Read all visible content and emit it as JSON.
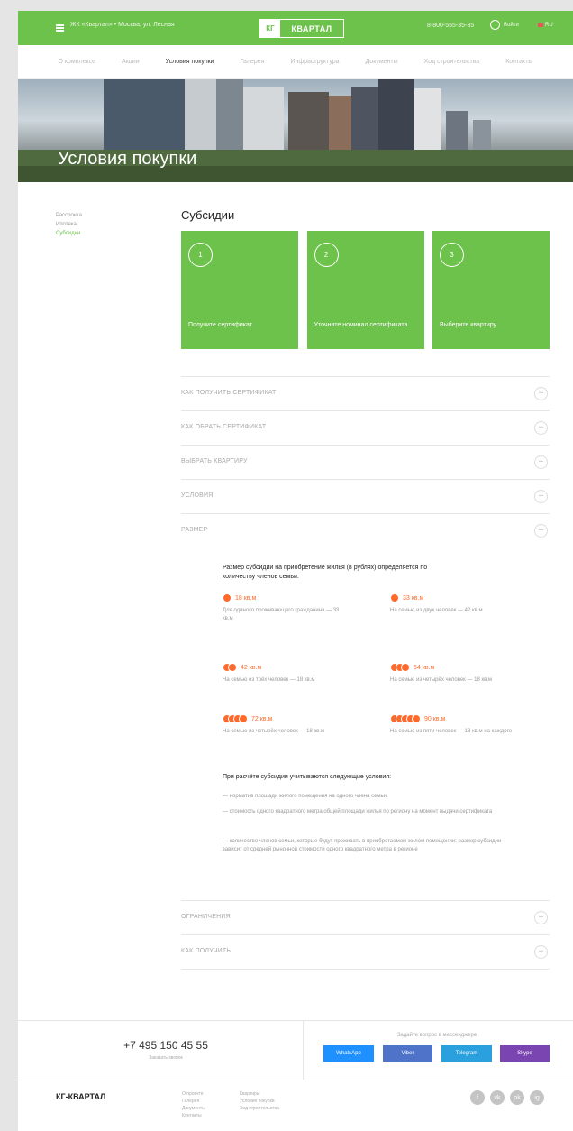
{
  "header": {
    "address": "ЖК «Квартал» • Москва, ул. Лесная",
    "logo_mark": "КГ",
    "logo_word": "КВАРТАЛ",
    "phone": "8-800-555-35-35",
    "login": "Войти",
    "lang": "RU"
  },
  "nav": [
    "О комплексе",
    "Акции",
    "Условия покупки",
    "Галерея",
    "Инфраструктура",
    "Документы",
    "Ход строительства",
    "Контакты"
  ],
  "hero": {
    "title": "Условия покупки"
  },
  "sidebar": [
    "Рассрочка",
    "Ипотека",
    "Субсидии"
  ],
  "subsidy": {
    "title": "Субсидии",
    "steps": [
      {
        "num": "1",
        "text": "Получите сертификат"
      },
      {
        "num": "2",
        "text": "Уточните номинал сертификата"
      },
      {
        "num": "3",
        "text": "Выберите квартиру"
      }
    ]
  },
  "accordion": [
    "КАК ПОЛУЧИТЬ СЕРТИФИКАТ",
    "КАК ОБРАТЬ СЕРТИФИКАТ",
    "ВЫБРАТЬ КВАРТИРУ",
    "УСЛОВИЯ",
    "РАЗМЕР",
    "ОГРАНИЧЕНИЯ",
    "КАК ПОЛУЧИТЬ"
  ],
  "size": {
    "intro": "Размер субсидии на приобретение жилья (в рублях) определяется по количеству членов семьи.",
    "values": [
      {
        "amount": "18 кв.м",
        "desc": "Для одиноко проживающего гражданина — 33 кв.м"
      },
      {
        "amount": "33 кв.м",
        "desc": "На семью из двух человек — 42 кв.м"
      },
      {
        "amount": "42 кв.м",
        "desc": "На семью из трёх человек — 18 кв.м"
      },
      {
        "amount": "54 кв.м",
        "desc": "На семью из четырёх человек — 18 кв.м"
      },
      {
        "amount": "72 кв.м",
        "desc": "На семью из четырёх человек — 18 кв.м"
      },
      {
        "amount": "90 кв.м",
        "desc": "На семью из пяти человек — 18 кв.м на каждого"
      }
    ],
    "conditions_title": "При расчёте субсидии учитываются следующие условия:",
    "conditions": [
      "— норматив площади жилого помещения на одного члена семьи",
      "— стоимость одного квадратного метра общей площади жилья по региону на момент выдачи сертификата",
      "— количество членов семьи, которые будут проживать в приобретаемом жилом помещении; размер субсидии зависит от средней рыночной стоимости одного квадратного метра в регионе"
    ]
  },
  "footer": {
    "phone": "+7 495 150 45 55",
    "phone_sub": "Заказать звонок",
    "messengers_caption": "Задайте вопрос в мессенджере",
    "messengers": [
      "WhatsApp",
      "Viber",
      "Telegram",
      "Skype"
    ],
    "colors": [
      "#1e90ff",
      "#4e73c8",
      "#2aa1de",
      "#7a45b0"
    ],
    "logo": "КГ-КВАРТАЛ",
    "links_a": [
      "О проекте",
      "Галерея",
      "Документы",
      "Контакты"
    ],
    "links_b": [
      "Квартиры",
      "Условия покупки",
      "Ход строительства"
    ],
    "social": [
      "f",
      "vk",
      "ok",
      "ig"
    ]
  }
}
